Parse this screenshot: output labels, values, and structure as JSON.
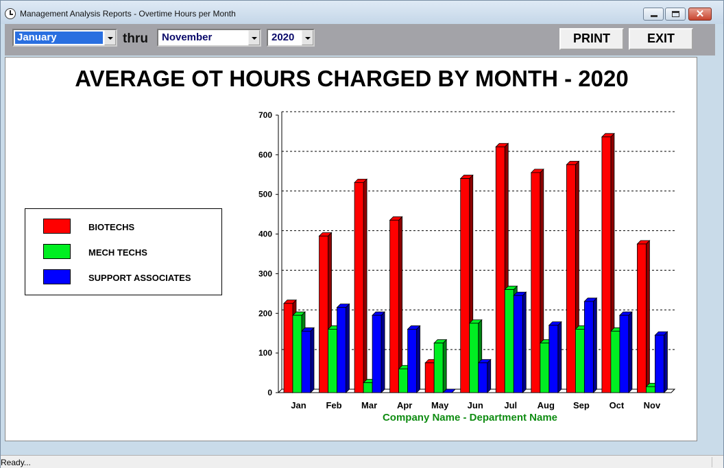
{
  "window": {
    "title": "Management Analysis Reports - Overtime Hours per Month",
    "close_glyph": "✕"
  },
  "toolbar": {
    "from_month": "January",
    "thru_label": "thru",
    "to_month": "November",
    "year": "2020",
    "print_label": "PRINT",
    "exit_label": "EXIT"
  },
  "report": {
    "title": "AVERAGE OT HOURS CHARGED BY MONTH - 2020",
    "subtitle": "Company Name - Department Name"
  },
  "legend": [
    {
      "label": "BIOTECHS",
      "color": "#ff0000"
    },
    {
      "label": "MECH TECHS",
      "color": "#00ee22"
    },
    {
      "label": "SUPPORT ASSOCIATES",
      "color": "#0000ff"
    }
  ],
  "chart_data": {
    "type": "bar",
    "categories": [
      "Jan",
      "Feb",
      "Mar",
      "Apr",
      "May",
      "Jun",
      "Jul",
      "Aug",
      "Sep",
      "Oct",
      "Nov"
    ],
    "series": [
      {
        "name": "BIOTECHS",
        "color": "#ff0000",
        "values": [
          225,
          395,
          530,
          435,
          75,
          540,
          620,
          555,
          575,
          645,
          375
        ]
      },
      {
        "name": "MECH TECHS",
        "color": "#00ee22",
        "values": [
          195,
          160,
          25,
          60,
          125,
          175,
          260,
          125,
          160,
          155,
          15
        ]
      },
      {
        "name": "SUPPORT ASSOCIATES",
        "color": "#0000ff",
        "values": [
          155,
          215,
          195,
          160,
          0,
          75,
          245,
          170,
          230,
          195,
          145
        ]
      }
    ],
    "y_ticks": [
      0,
      100,
      200,
      300,
      400,
      500,
      600,
      700
    ],
    "ylim": [
      0,
      700
    ],
    "grid": true,
    "legend_position": "left"
  },
  "status": {
    "text": "Ready..."
  }
}
